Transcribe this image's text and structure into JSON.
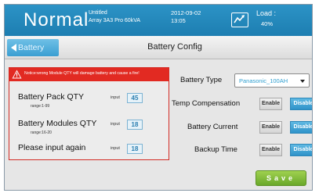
{
  "header": {
    "mode": "Normal",
    "system_line1": "Untitled",
    "system_line2": "Array 3A3 Pro 60kVA",
    "date": "2012-09-02",
    "time": "13:05",
    "icon": "chart-monitor-icon",
    "load_label": "Load :",
    "load_value": "40%"
  },
  "nav": {
    "back_label": "Battery",
    "title": "Battery Config"
  },
  "config": {
    "battery_type_label": "Battery Type",
    "battery_type_value": "Panasonic_100AH",
    "temp_comp_label": "Temp Compensation",
    "battery_current_label": "Battery Current",
    "backup_time_label": "Backup Time",
    "enable_label": "Enable",
    "disable_label": "Disable",
    "save_label": "Save"
  },
  "popup": {
    "warning": "Notice:wrong Module QTY will damage battery and cause a fire!",
    "input_label": "input",
    "pack_qty_label": "Battery Pack QTY",
    "pack_qty_range": "range:1-99",
    "pack_qty_value": "45",
    "modules_qty_label": "Battery Modules QTY",
    "modules_qty_range": "range:16-20",
    "modules_qty_value": "18",
    "again_label": "Please input again",
    "again_value": "18"
  },
  "colors": {
    "header_blue": "#1d7eb1",
    "accent_blue": "#2f93c9",
    "warning_red": "#e22a22",
    "save_green": "#6aa82a",
    "dropdown_text": "#2f9fd0"
  }
}
